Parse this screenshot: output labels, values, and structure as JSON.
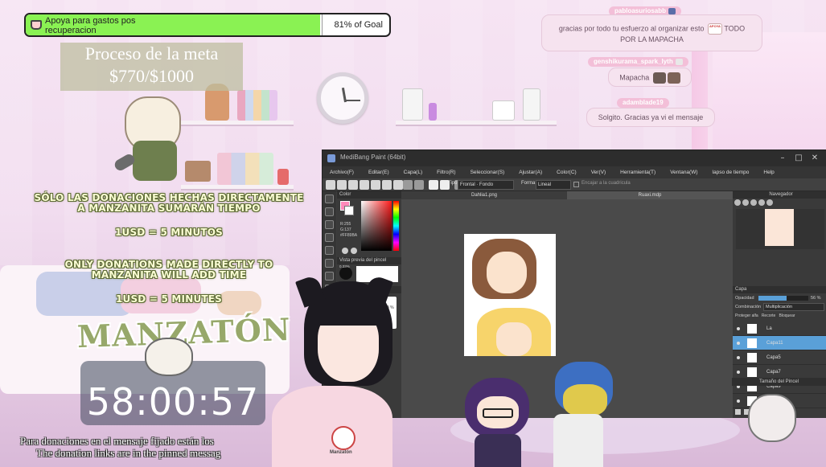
{
  "goal": {
    "label": "Apoya para gastos pos recuperacion",
    "percent_text": "81% of Goal",
    "fill_percent": 81,
    "fill_color": "#8af253",
    "icon": "coffee-cup-icon"
  },
  "progress": {
    "title": "Proceso de la meta",
    "amount": "$770/$1000"
  },
  "chat": [
    {
      "user": "pabloasuriosabb",
      "message": "gracias por todo tu esfuerzo al organizar esto",
      "message_tail": "TODO POR LA MAPACHA",
      "emote_text": "APOYA"
    },
    {
      "user": "genshikurama_spark_lyth",
      "message": "Mapacha"
    },
    {
      "user": "adamblade19",
      "message": "Solgito. Gracias ya vi el mensaje"
    }
  ],
  "rules": {
    "es_line": "SÓLO LAS DONACIONES HECHAS DIRECTAMENTE A MANZANITA SUMARÁN TIEMPO",
    "es_rate": "1USD = 5 MINUTOS",
    "en_line": "ONLY DONATIONS MADE DIRECTLY TO MANZANITA WILL ADD TIME",
    "en_rate": "1USD = 5 MINUTES"
  },
  "marathon": {
    "title": "MANZATÓN",
    "timer": "58:00:57"
  },
  "donation_notice": {
    "es": "Para donaciones en el mensaje fijado están los",
    "en": "The donation links are in the pinned messag"
  },
  "app": {
    "title": "MediBang Paint (64bit)",
    "menu": [
      "Archivo(F)",
      "Editar(E)",
      "Capa(L)",
      "Filtro(R)",
      "Seleccionar(S)",
      "Ajustar(A)",
      "Color(C)",
      "Ver(V)",
      "Herramienta(T)",
      "Ventana(W)",
      "lapso de tiempo",
      "Help"
    ],
    "toolbar": {
      "tipo_label": "Tipo",
      "tipo_value": "Frontal",
      "tipo_value2": "Fondo",
      "forma_label": "Forma",
      "forma_value": "Lineal",
      "grid_label": "Encajar a la cuadricula"
    },
    "tabs": [
      "Dahlia1.png",
      "Ruaxi.mdp"
    ],
    "color_panel": {
      "title": "Color",
      "r": "R:255",
      "g": "G:137",
      "hex": "#FF89BA",
      "swatch_color": "#ff89ba"
    },
    "brush_panel_title": "Vista previa del pincel",
    "brush_size": "0.33%",
    "brush_control_title": "Control del pincel",
    "brush_control_value": "3 %",
    "navigator_title": "Navegador",
    "layer_panel": {
      "title": "Capa",
      "opacity_label": "Opacidad",
      "opacity_value": "56 %",
      "blend_label": "Combinación",
      "blend_value": "Multiplicación",
      "protect_label": "Proteger alfa",
      "clip_label": "Recorte",
      "lock_label": "Bloquear",
      "layers": [
        {
          "name": "La",
          "selected": false
        },
        {
          "name": "Capa11",
          "selected": true
        },
        {
          "name": "Capa5",
          "selected": false
        },
        {
          "name": "Capa7",
          "selected": false
        },
        {
          "name": "Capa9",
          "selected": false
        },
        {
          "name": "Capa10",
          "selected": false
        }
      ]
    },
    "brush_size_panel_title": "Tamaño del Pincel"
  },
  "mascot_label": "Manzatón"
}
